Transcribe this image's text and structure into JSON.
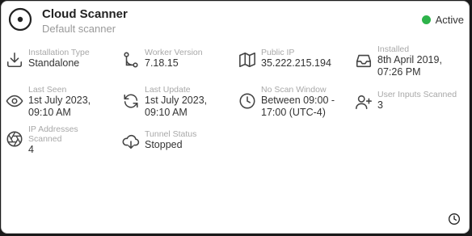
{
  "header": {
    "title": "Cloud Scanner",
    "subtitle": "Default scanner",
    "status": "Active",
    "status_color": "#2db34a"
  },
  "fields": [
    {
      "label": "Installation Type",
      "value": "Standalone",
      "icon": "download-icon"
    },
    {
      "label": "Worker Version",
      "value": "7.18.15",
      "icon": "branch-icon"
    },
    {
      "label": "Public IP",
      "value": "35.222.215.194",
      "icon": "map-icon"
    },
    {
      "label": "Installed",
      "value": "8th April 2019, 07:26 PM",
      "icon": "inbox-icon"
    },
    {
      "label": "Last Seen",
      "value": "1st July 2023, 09:10 AM",
      "icon": "eye-icon"
    },
    {
      "label": "Last Update",
      "value": "1st July 2023, 09:10 AM",
      "icon": "refresh-icon"
    },
    {
      "label": "No Scan Window",
      "value": "Between 09:00 - 17:00 (UTC-4)",
      "icon": "clock-icon"
    },
    {
      "label": "User Inputs Scanned",
      "value": "3",
      "icon": "user-add-icon"
    },
    {
      "label": "IP Addresses Scanned",
      "value": "4",
      "icon": "aperture-icon"
    },
    {
      "label": "Tunnel Status",
      "value": "Stopped",
      "icon": "cloud-download-icon"
    }
  ]
}
